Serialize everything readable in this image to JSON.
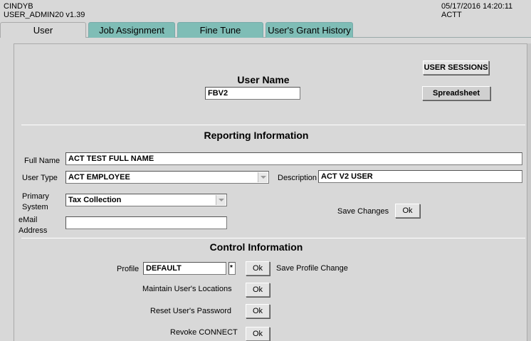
{
  "header": {
    "user": "CINDYB",
    "app_version": "USER_ADMIN20 v1.39",
    "datetime": "05/17/2016 14:20:11",
    "system": "ACTT"
  },
  "tabs": [
    {
      "label": "User",
      "active": true
    },
    {
      "label": "Job Assignment",
      "active": false
    },
    {
      "label": "Fine Tune",
      "active": false
    },
    {
      "label": "User's Grant History",
      "active": false
    }
  ],
  "user_section": {
    "title": "User Name",
    "username_value": "FBV2",
    "sessions_button": "USER SESSIONS",
    "spreadsheet_button": "Spreadsheet"
  },
  "reporting": {
    "title": "Reporting Information",
    "full_name_label": "Full Name",
    "full_name_value": "ACT TEST FULL NAME",
    "user_type_label": "User Type",
    "user_type_value": "ACT EMPLOYEE",
    "description_label": "Description",
    "description_value": "ACT V2 USER",
    "primary_system_label_1": "Primary",
    "primary_system_label_2": "System",
    "primary_system_value": "Tax Collection",
    "email_label_1": "eMail",
    "email_label_2": "Address",
    "email_value": "",
    "save_changes_label": "Save Changes",
    "ok_label": "Ok"
  },
  "control": {
    "title": "Control Information",
    "profile_label": "Profile",
    "profile_value": "DEFAULT",
    "profile_lov": "*",
    "save_profile_label": "Save Profile Change",
    "maintain_locations_label": "Maintain User's  Locations",
    "reset_password_label": "Reset User's Password",
    "revoke_connect_label": "Revoke CONNECT",
    "ok_label": "Ok"
  },
  "colors": {
    "background": "#d8d8d8",
    "tab_inactive": "#7fbdb6"
  }
}
